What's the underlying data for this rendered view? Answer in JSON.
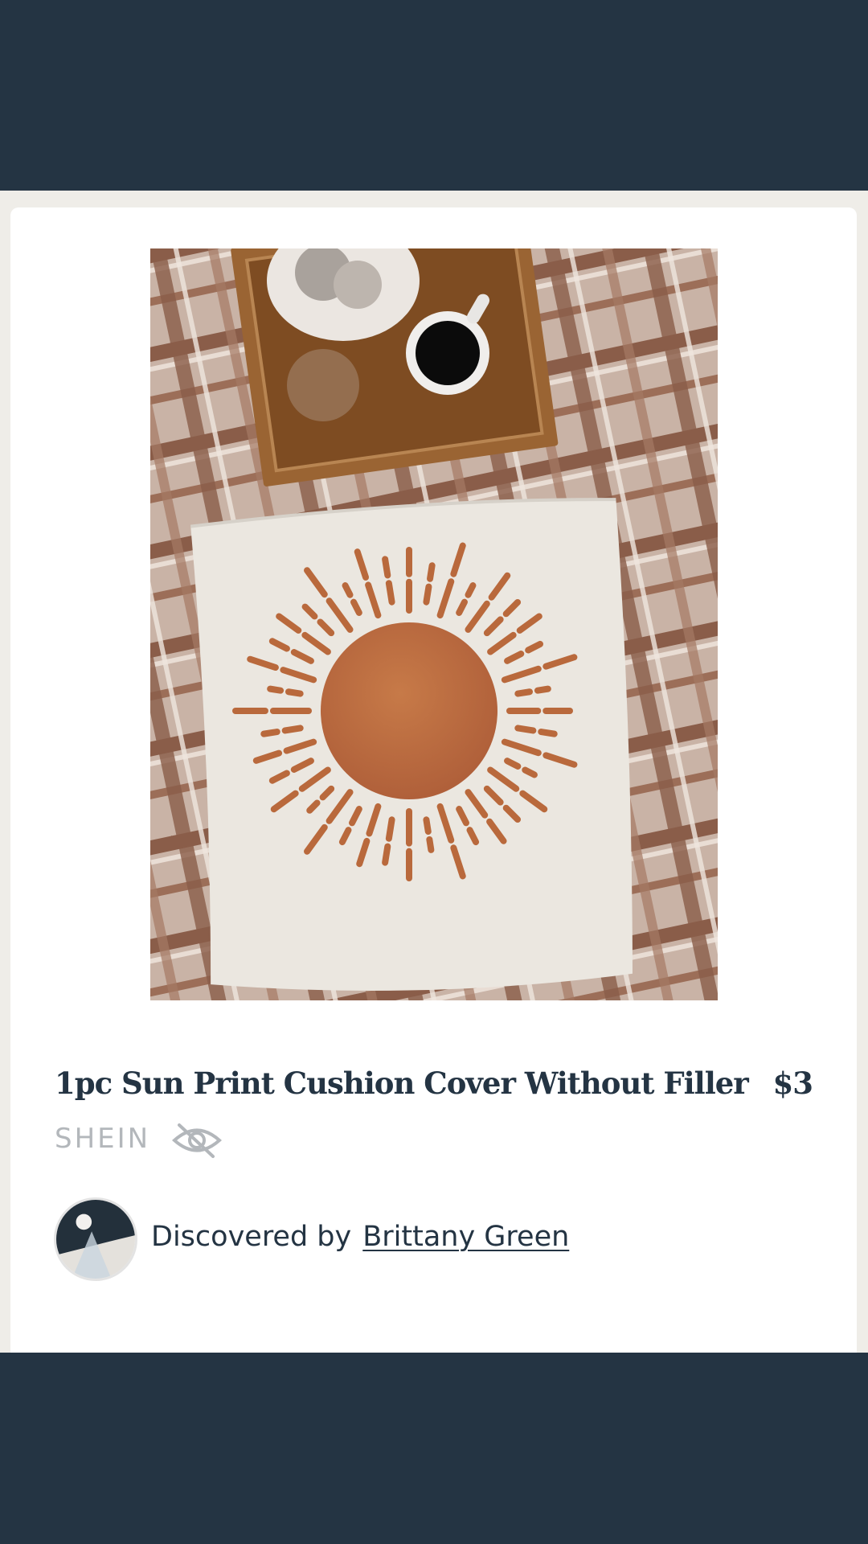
{
  "product": {
    "title": "1pc Sun Print Cushion Cover Without Filler",
    "price": "$3",
    "store": "SHEIN",
    "image_icon": "sun-print-cushion-photo",
    "hide_icon": "eye-slash-icon"
  },
  "discovery": {
    "prefix": "Discovered by",
    "user_name": "Brittany Green",
    "avatar_icon": "user-avatar"
  },
  "colors": {
    "frame": "#243443",
    "text_primary": "#243443",
    "text_muted": "#b3b7bb",
    "card_bg": "#ffffff",
    "sheet_bg": "#efede8",
    "sun_orange": "#b9693c"
  }
}
